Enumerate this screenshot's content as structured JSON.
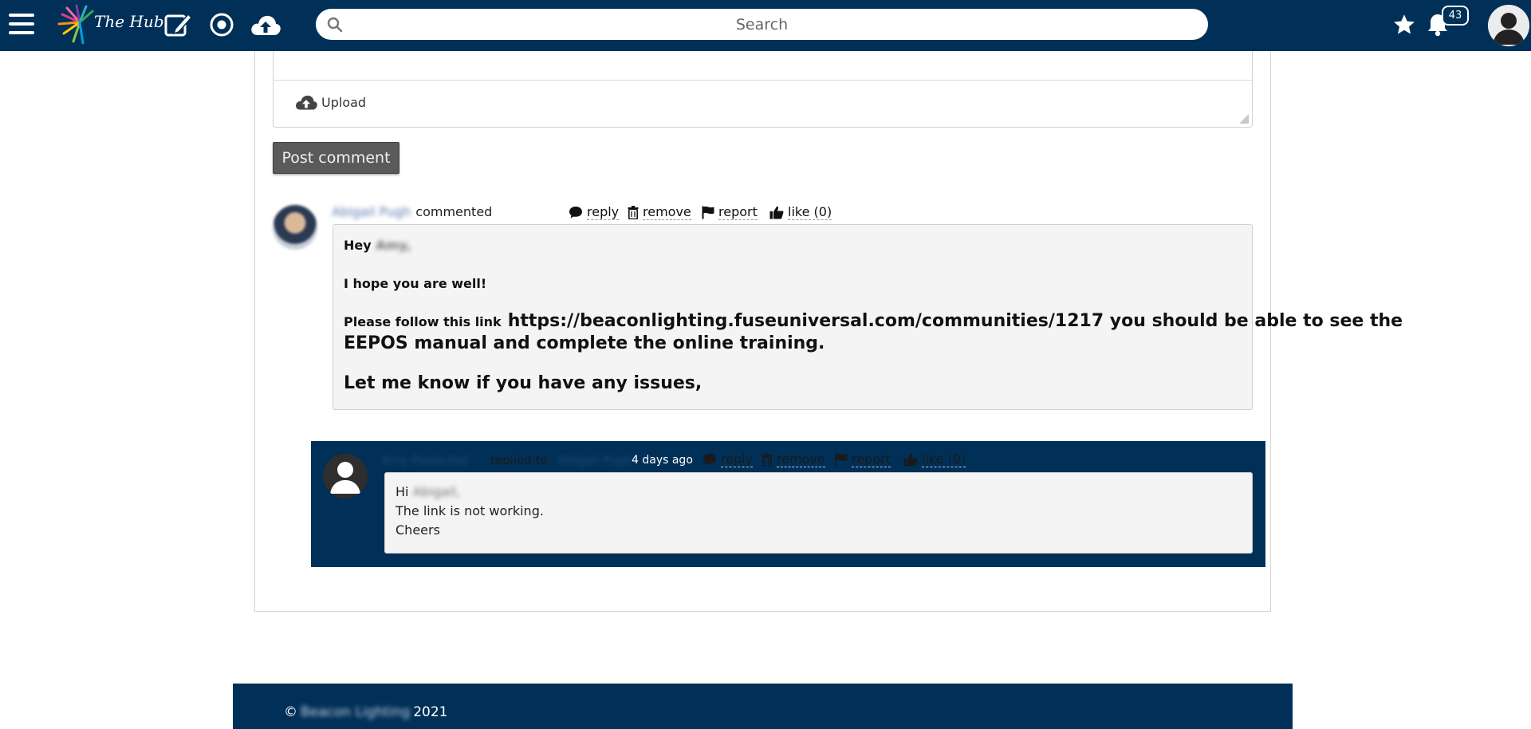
{
  "header": {
    "logo_text": "The Hub",
    "search_placeholder": "Search",
    "notification_count": "43"
  },
  "editor": {
    "upload_label": "Upload",
    "post_button_label": "Post comment"
  },
  "comment": {
    "author": "Abigail Pugh",
    "verb": "commented",
    "actions": {
      "reply": "reply",
      "remove": "remove",
      "report": "report",
      "like": "like (0)"
    },
    "greeting_prefix": "Hey",
    "greeting_name": "Amy,",
    "line2": "I hope you are well!",
    "line3_prefix": "Please follow this link",
    "line3_link": "https://beaconlighting.fuseuniversal.com/communities/1217  you should be able to see the",
    "line3_cont": "EEPOS manual and complete the online training.",
    "line4": "Let me know if you have any issues,"
  },
  "reply": {
    "author": "Amy Redacted",
    "verb": "replied to",
    "target": "Abigail Pugh",
    "time": "4 days ago",
    "actions": {
      "reply": "reply",
      "remove": "remove",
      "report": "report",
      "like": "like (0)"
    },
    "greeting_prefix": "Hi",
    "greeting_name": "Abigail,",
    "line2": "The link is not working.",
    "line3": "Cheers"
  },
  "footer": {
    "copyright_symbol": "©",
    "company": "Beacon Lighting",
    "year": "2021"
  },
  "colors": {
    "brand_navy": "#003057",
    "post_button": "#5a5a5a",
    "comment_bg": "#f4f4f4"
  }
}
